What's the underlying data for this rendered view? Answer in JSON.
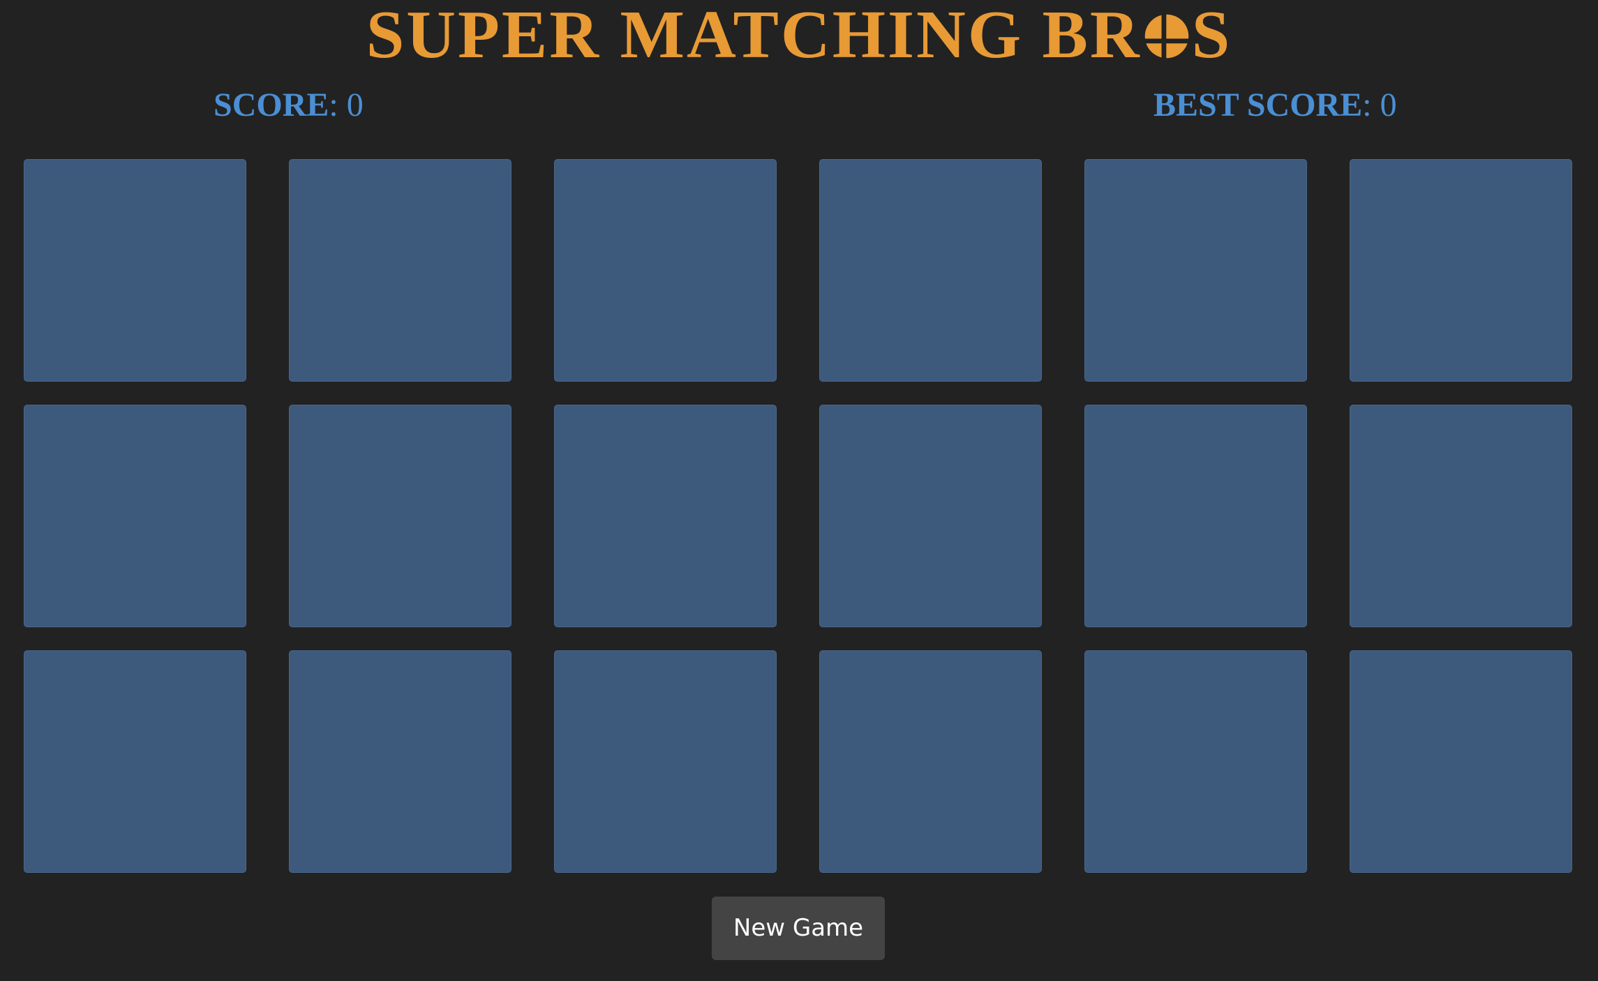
{
  "title": {
    "before_logo": "SUPER MATCHING BR",
    "logo": "smash-ball-icon",
    "after_logo": "S"
  },
  "score": {
    "label": "SCORE",
    "separator": ":",
    "value": "0"
  },
  "best_score": {
    "label": "BEST SCORE",
    "separator": ":",
    "value": "0"
  },
  "board": {
    "rows": 3,
    "columns": 6,
    "cards_face_down": 18
  },
  "new_game_button": {
    "label": "New Game"
  },
  "colors": {
    "background": "#222222",
    "title": "#E89A35",
    "score": "#4A8FD4",
    "card_back": "#3D5A7D",
    "button": "#444444",
    "button_text": "#FFFFFF"
  }
}
